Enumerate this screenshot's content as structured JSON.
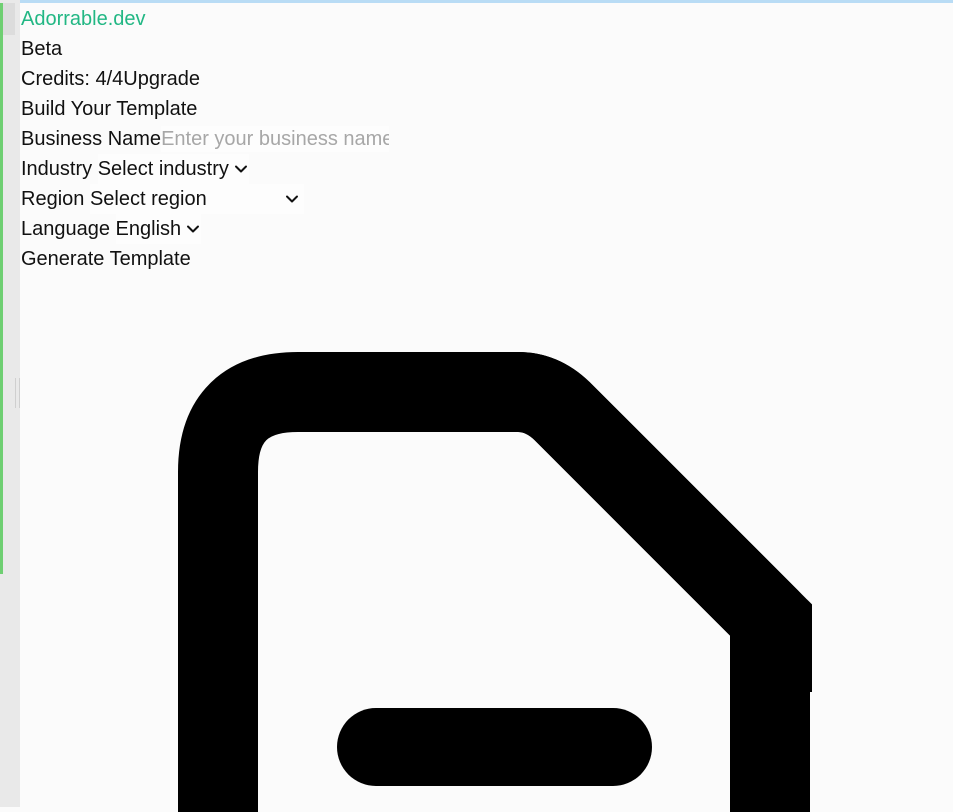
{
  "brand": {
    "name": "Adorrable.dev",
    "badge": "Beta"
  },
  "credits": {
    "label": "Credits: 4/4",
    "upgrade": "Upgrade"
  },
  "form": {
    "title": "Build Your Template",
    "business_name": {
      "label": "Business Name",
      "placeholder": "Enter your business name"
    },
    "industry": {
      "label": "Industry",
      "value": "Select industry"
    },
    "region": {
      "label": "Region",
      "value": "Select region"
    },
    "language": {
      "label": "Language",
      "value": "English"
    },
    "generate": "Generate Template"
  },
  "icons": {
    "main": "file-minus-icon",
    "chevron": "chevron-down-icon"
  },
  "colors": {
    "brand": "#22b784",
    "top_bar": "#b9dcf5",
    "accent": "#6fcf72"
  }
}
